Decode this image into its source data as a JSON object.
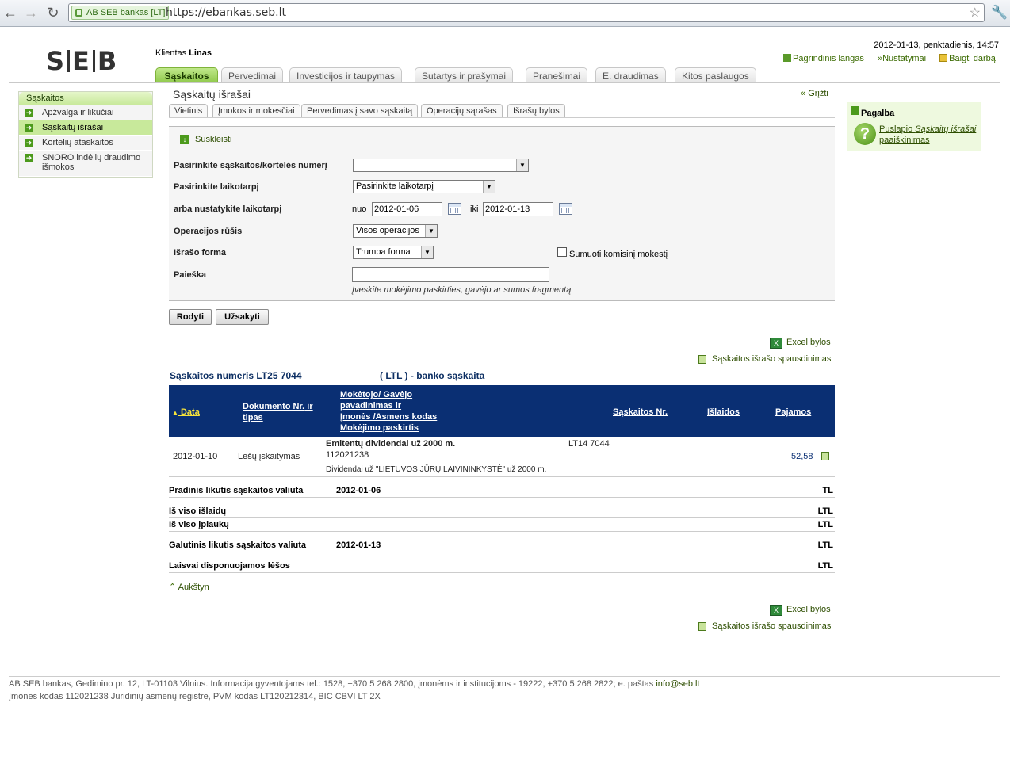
{
  "browser": {
    "security_badge": "AB SEB bankas [LT]",
    "url": "https://ebankas.seb.lt"
  },
  "header": {
    "logo": "S|E|B",
    "client_prefix": "Klientas",
    "client_name": "Linas",
    "datetime": "2012-01-13, penktadienis, 14:57",
    "links": {
      "home": "Pagrindinis langas",
      "settings": "Nustatymai",
      "logout": "Baigti darbą"
    }
  },
  "main_tabs": [
    "Sąskaitos",
    "Pervedimai",
    "Investicijos ir taupymas",
    "Sutartys ir prašymai",
    "Pranešimai",
    "E. draudimas",
    "Kitos paslaugos"
  ],
  "sidebar": {
    "title": "Sąskaitos",
    "items": [
      "Apžvalga ir likučiai",
      "Sąskaitų išrašai",
      "Kortelių ataskaitos",
      "SNORO indėlių draudimo išmokos"
    ]
  },
  "content": {
    "page_title": "Sąskaitų išrašai",
    "back": "Grįžti",
    "sub_tabs": [
      "Vietinis",
      "Įmokos ir mokesčiai",
      "Pervedimas į savo sąskaitą",
      "Operacijų sąrašas",
      "Išrašų bylos"
    ],
    "collapse": "Suskleisti"
  },
  "form": {
    "account_label": "Pasirinkite sąskaitos/kortelės numerį",
    "account_value": "",
    "period_label": "Pasirinkite laikotarpį",
    "period_value": "Pasirinkite laikotarpį",
    "custom_period_label": "arba nustatykite laikotarpį",
    "from_label": "nuo",
    "from_value": "2012-01-06",
    "to_label": "iki",
    "to_value": "2012-01-13",
    "op_type_label": "Operacijos rūšis",
    "op_type_value": "Visos operacijos",
    "format_label": "Išrašo forma",
    "format_value": "Trumpa forma",
    "fee_checkbox_label": "Sumuoti komisinį mokestį",
    "fee_checked": false,
    "search_label": "Paieška",
    "search_value": "",
    "search_hint": "Įveskite mokėjimo paskirties, gavėjo ar sumos fragmentą"
  },
  "buttons": {
    "show": "Rodyti",
    "order": "Užsakyti"
  },
  "downloads": {
    "excel": "Excel bylos",
    "print": "Sąskaitos išrašo spausdinimas"
  },
  "account": {
    "number_label": "Sąskaitos numeris LT25 7044",
    "currency_label": "( LTL ) - banko sąskaita"
  },
  "table": {
    "headers": {
      "date": "Data",
      "doc_line1": "Dokumento Nr.",
      "doc_line1_suffix": " ir",
      "doc_line2": "tipas",
      "payer_line1": "Mokėtojo/ Gavėjo",
      "payer_line2": "pavadinimas",
      "payer_line2_suffix": " ir",
      "payer_line3": "Įmonės /Asmens kodas",
      "payer_line4": "Mokėjimo paskirtis",
      "account_no": "Sąskaitos Nr.",
      "expenses": "Išlaidos",
      "income": "Pajamos"
    },
    "rows": [
      {
        "date": "2012-01-10",
        "doc_type": "Lėšų įskaitymas",
        "payer": "Emitentų dividendai už 2000 m.",
        "code": "112021238",
        "purpose": "Dividendai už \"LIETUVOS JŪRŲ LAIVININKYSTĖ\" už 2000 m.",
        "account": "LT14 7044",
        "expense": "",
        "income": "52,58"
      }
    ]
  },
  "summary": {
    "opening_label": "Pradinis likutis sąskaitos valiuta",
    "opening_date": "2012-01-06",
    "opening_currency": "TL",
    "total_exp_label": "Iš viso išlaidų",
    "total_exp_currency": "LTL",
    "total_inc_label": "Iš viso įplaukų",
    "total_inc_currency": "LTL",
    "closing_label": "Galutinis likutis sąskaitos valiuta",
    "closing_date": "2012-01-13",
    "closing_currency": "LTL",
    "available_label": "Laisvai disponuojamos lėšos",
    "available_currency": "LTL"
  },
  "top_link": "Aukštyn",
  "help": {
    "title": "Pagalba",
    "link_prefix": "Puslapio ",
    "link_em": "Sąskaitų išrašai",
    "link_suffix": " paaiškinimas"
  },
  "footer": {
    "line1_text": "AB SEB bankas, Gedimino pr. 12, LT-01103 Vilnius. Informacija gyventojams tel.: 1528, +370 5 268 2800, įmonėms ir institucijoms - 19222, +370 5 268 2822; e. paštas ",
    "email": "info@seb.lt",
    "line2": "Įmonės kodas 112021238 Juridinių asmenų registre, PVM kodas LT120212314, BIC CBVI LT 2X"
  },
  "colors": {
    "accent_green": "#8ec84a",
    "table_header": "#0a2f73",
    "link": "#2d4e00"
  }
}
